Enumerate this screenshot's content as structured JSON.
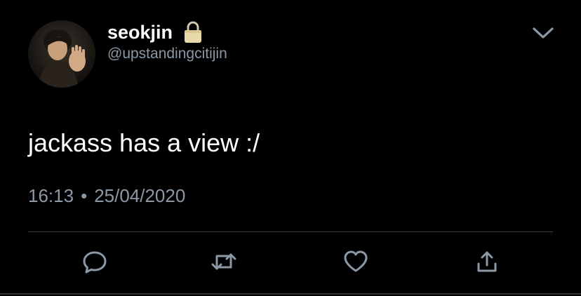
{
  "tweet": {
    "display_name": "seokjin",
    "handle": "@upstandingcitijin",
    "protected": true,
    "text": "jackass has a view :/",
    "time": "16:13",
    "separator": "•",
    "date": "25/04/2020"
  },
  "icons": {
    "lock": "lock-icon",
    "caret": "chevron-down-icon",
    "reply": "reply-icon",
    "retweet": "retweet-icon",
    "like": "heart-icon",
    "share": "share-icon"
  },
  "colors": {
    "background": "#000000",
    "text": "#ffffff",
    "muted": "#8b98a5",
    "lock": "#e8d9a8",
    "divider": "#38444d"
  }
}
